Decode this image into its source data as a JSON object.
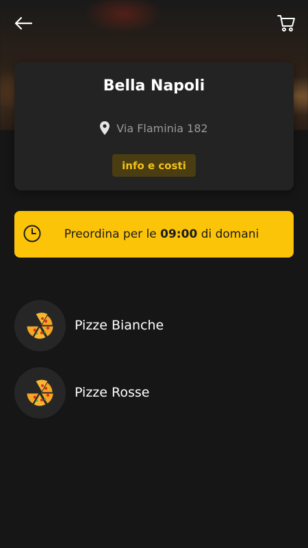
{
  "header": {
    "back_icon": "arrow-left-icon",
    "cart_icon": "shopping-cart-icon"
  },
  "restaurant": {
    "name": "Bella Napoli",
    "address": "Via Flaminia 182",
    "info_button": "info e costi"
  },
  "preorder": {
    "text_before": "Preordina per le ",
    "time": "09:00",
    "text_after": " di domani",
    "accent": "#fcc409"
  },
  "categories": [
    {
      "label": "Pizze Bianche",
      "icon": "pizza-icon"
    },
    {
      "label": "Pizze Rosse",
      "icon": "pizza-icon"
    }
  ],
  "colors": {
    "background": "#161616",
    "card": "#232323",
    "info_button_bg": "#4a3d12",
    "info_button_text": "#f3c21b"
  }
}
